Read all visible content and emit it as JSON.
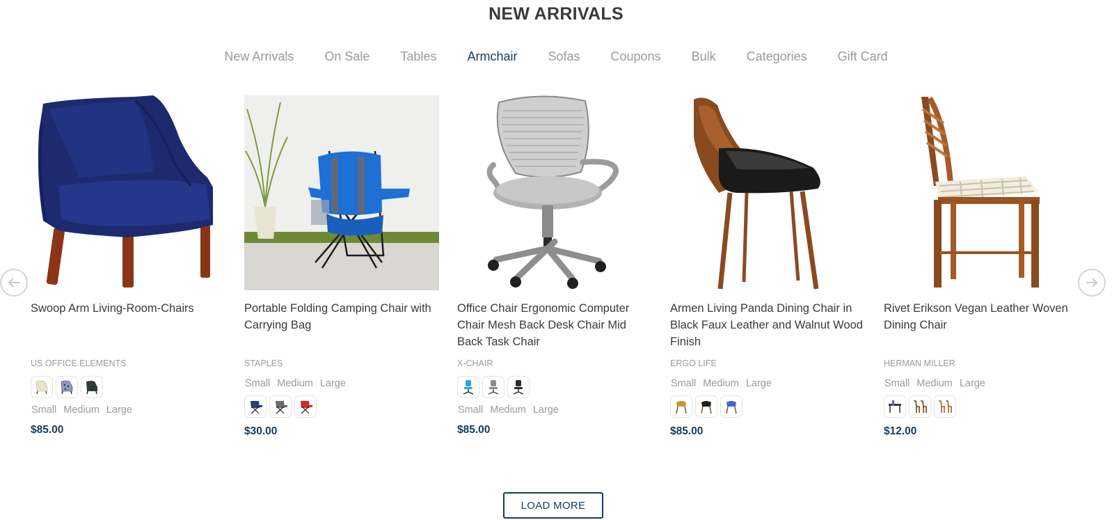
{
  "section": {
    "title": "NEW ARRIVALS"
  },
  "tabs": [
    {
      "label": "New Arrivals"
    },
    {
      "label": "On Sale"
    },
    {
      "label": "Tables"
    },
    {
      "label": "Armchair",
      "active": true
    },
    {
      "label": "Sofas"
    },
    {
      "label": "Coupons"
    },
    {
      "label": "Bulk"
    },
    {
      "label": "Categories"
    },
    {
      "label": "Gift Card"
    }
  ],
  "colors": {
    "accent": "#143c5c",
    "muted": "#9a9a9a",
    "text": "#3a3a3a"
  },
  "products": [
    {
      "title": "Swoop Arm Living-Room-Chairs",
      "brand": "US OFFICE ELEMENTS",
      "sizes": [
        "Small",
        "Medium",
        "Large"
      ],
      "price": "$85.00",
      "image": "navy-armchair",
      "swatches": [
        "cream-armchair",
        "patterned-armchair",
        "dark-green-armchair"
      ]
    },
    {
      "title": "Portable Folding Camping Chair with Carrying Bag",
      "brand": "STAPLES",
      "sizes": [
        "Small",
        "Medium",
        "Large"
      ],
      "price": "$30.00",
      "image": "blue-camping-chair",
      "swatches": [
        "navy-camping-chair",
        "grey-camping-chair",
        "red-camping-chair"
      ]
    },
    {
      "title": "Office Chair Ergonomic Computer Chair Mesh Back Desk Chair Mid Back Task Chair",
      "brand": "X-CHAIR",
      "sizes": [
        "Small",
        "Medium",
        "Large"
      ],
      "price": "$85.00",
      "image": "grey-mesh-office-chair",
      "swatches": [
        "blue-office-chair",
        "grey-office-chair",
        "black-office-chair"
      ]
    },
    {
      "title": "Armen Living Panda Dining Chair in Black Faux Leather and Walnut Wood Finish",
      "brand": "ERGO LIFE",
      "sizes": [
        "Small",
        "Medium",
        "Large"
      ],
      "price": "$85.00",
      "image": "black-walnut-dining-chair",
      "swatches": [
        "mustard-dining-chair",
        "black-dining-chair",
        "blue-dining-chair"
      ]
    },
    {
      "title": "Rivet Erikson Vegan Leather Woven Dining Chair",
      "brand": "HERMAN MILLER",
      "sizes": [
        "Small",
        "Medium",
        "Large"
      ],
      "price": "$12.00",
      "image": "woven-wood-dining-chair",
      "swatches": [
        "dark-dining-set",
        "brown-dining-chairs",
        "wood-dining-chairs"
      ]
    }
  ],
  "nav": {
    "prev_icon": "arrow-left-icon",
    "next_icon": "arrow-right-icon"
  },
  "load_more": {
    "label": "LOAD MORE"
  }
}
